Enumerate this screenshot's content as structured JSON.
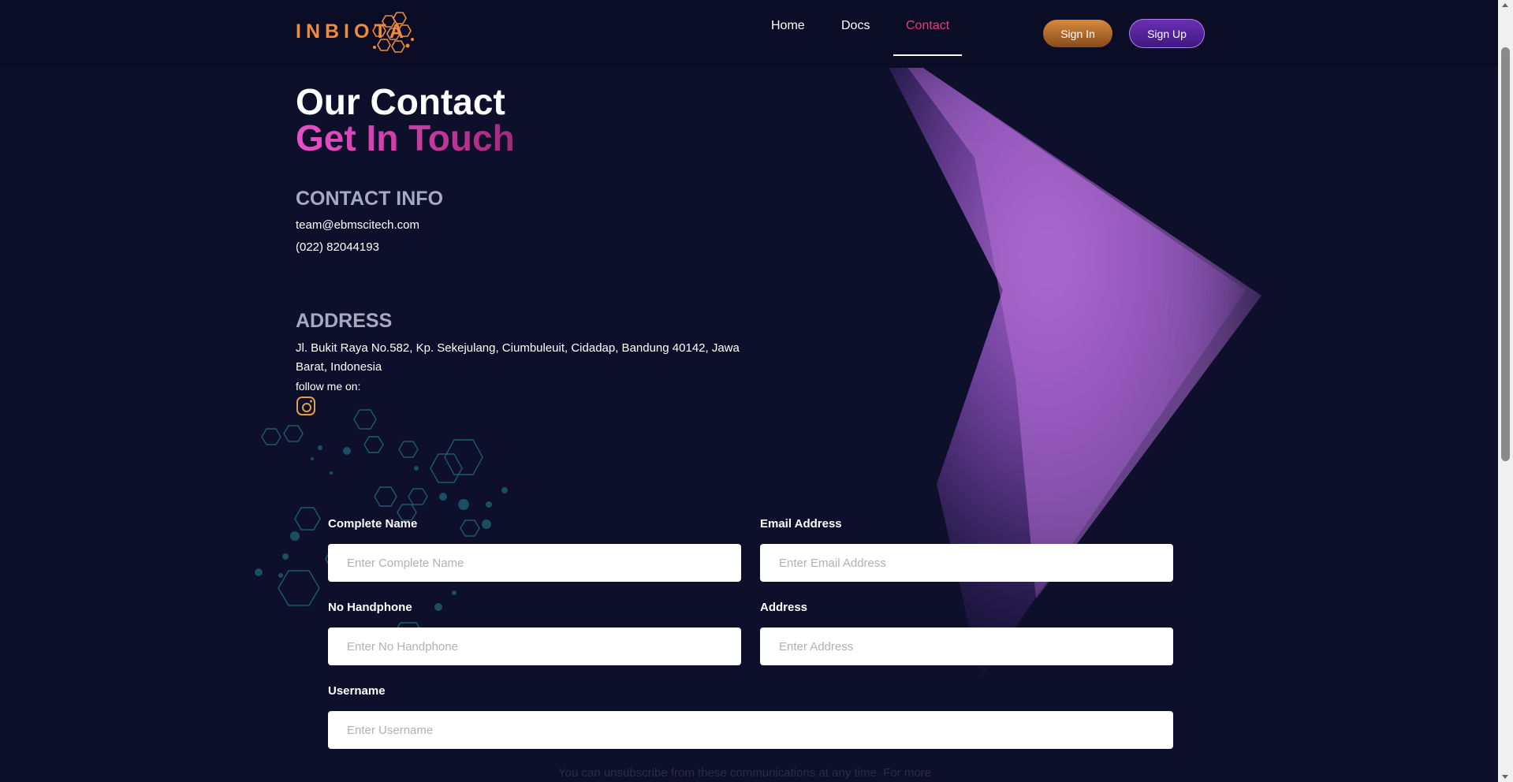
{
  "header": {
    "logo_text": "INBIOTA",
    "nav": {
      "home": "Home",
      "docs": "Docs",
      "contact": "Contact"
    },
    "sign_in": "Sign In",
    "sign_up": "Sign Up"
  },
  "hero": {
    "title": "Our Contact",
    "subtitle": "Get In Touch"
  },
  "contact_info": {
    "heading": "CONTACT INFO",
    "email": "team@ebmscitech.com",
    "phone": "(022) 82044193"
  },
  "address": {
    "heading": "ADDRESS",
    "text": "Jl. Bukit Raya No.582, Kp. Sekejulang, Ciumbuleuit, Cidadap, Bandung 40142, Jawa Barat, Indonesia",
    "follow_label": "follow me on:",
    "social_icon": "instagram-icon"
  },
  "form": {
    "complete_name": {
      "label": "Complete Name",
      "placeholder": "Enter Complete Name"
    },
    "email": {
      "label": "Email Address",
      "placeholder": "Enter Email Address"
    },
    "phone": {
      "label": "No Handphone",
      "placeholder": "Enter No Handphone"
    },
    "address": {
      "label": "Address",
      "placeholder": "Enter Address"
    },
    "username": {
      "label": "Username",
      "placeholder": "Enter Username"
    }
  },
  "footer_note": "You can unsubscribe from these communications at any time. For more",
  "colors": {
    "background": "#0d0f2b",
    "accent_pink": "#e0407a",
    "logo_orange": "#f08a3c",
    "sign_in": "#c07a36",
    "sign_up": "#5a26a0"
  }
}
